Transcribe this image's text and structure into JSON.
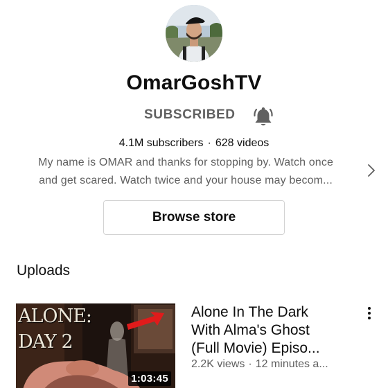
{
  "channel": {
    "name": "OmarGoshTV",
    "avatar_icon": "profile-avatar",
    "subscribe_state": "SUBSCRIBED",
    "bell_icon": "bell-icon",
    "subscribers": "4.1M subscribers",
    "videos": "628 videos",
    "description_lines": [
      "My name is OMAR and thanks for stopping by. Watch once",
      "and get scared. Watch twice and your house may becom..."
    ],
    "description_chevron_icon": "chevron-right-icon",
    "browse_store": "Browse store"
  },
  "uploads": {
    "title": "Uploads",
    "items": [
      {
        "thumb_text_line1": "ALONE:",
        "thumb_text_line2": "DAY 2",
        "duration": "1:03:45",
        "title_lines": [
          "Alone In The Dark",
          "With Alma's Ghost",
          "(Full Movie) Episo..."
        ],
        "views": "2.2K views",
        "age": "12 minutes a...",
        "more_icon": "more-vert-icon"
      }
    ]
  },
  "colors": {
    "primary_text": "#0f0f0f",
    "secondary_text": "#606060",
    "border": "#d3d3d3",
    "thumb_arrow": "#e01b1b"
  }
}
